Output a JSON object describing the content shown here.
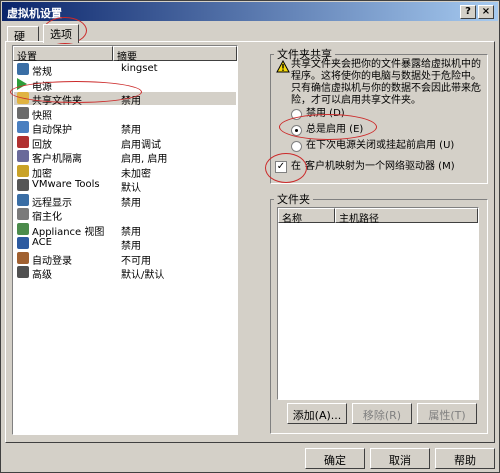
{
  "window": {
    "title": "虚拟机设置",
    "help_glyph": "?",
    "close_glyph": "×"
  },
  "tabs": [
    {
      "label": "硬件"
    },
    {
      "label": "选项"
    }
  ],
  "list": {
    "headers": {
      "setting": "设置",
      "summary": "摘要"
    },
    "items": [
      {
        "label": "常规",
        "summary": "kingset",
        "icon": "general-icon"
      },
      {
        "label": "电源",
        "summary": "",
        "icon": "power-icon"
      },
      {
        "label": "共享文件夹",
        "summary": "禁用",
        "icon": "folder-icon"
      },
      {
        "label": "快照",
        "summary": "",
        "icon": "snapshot-icon"
      },
      {
        "label": "自动保护",
        "summary": "禁用",
        "icon": "autoprotect-icon"
      },
      {
        "label": "回放",
        "summary": "启用调试",
        "icon": "replay-icon"
      },
      {
        "label": "客户机隔离",
        "summary": "启用, 启用",
        "icon": "isolation-icon"
      },
      {
        "label": "加密",
        "summary": "未加密",
        "icon": "lock-icon"
      },
      {
        "label": "VMware Tools",
        "summary": "默认",
        "icon": "vmware-tools-icon"
      },
      {
        "label": "远程显示",
        "summary": "禁用",
        "icon": "remote-display-icon"
      },
      {
        "label": "宿主化",
        "summary": "",
        "icon": "host-icon"
      },
      {
        "label": "Appliance 视图",
        "summary": "禁用",
        "icon": "appliance-icon"
      },
      {
        "label": "ACE",
        "summary": "禁用",
        "icon": "ace-icon"
      },
      {
        "label": "自动登录",
        "summary": "不可用",
        "icon": "autologin-icon"
      },
      {
        "label": "高级",
        "summary": "默认/默认",
        "icon": "advanced-icon"
      }
    ]
  },
  "sharing": {
    "group_label": "文件夹共享",
    "warning_lines": [
      "共享文件夹会把你的文件暴露给虚拟机中的",
      "程序。这将使你的电脑与数据处于危险中。",
      "只有确信虚拟机与你的数据不会因此带来危",
      "险，才可以启用共享文件夹。"
    ],
    "options": [
      {
        "label": "禁用 (D)",
        "selected": false
      },
      {
        "label": "总是启用 (E)",
        "selected": true
      },
      {
        "label": "在下次电源关闭或挂起前启用 (U)",
        "selected": false
      }
    ],
    "map_drive": {
      "checked": true,
      "label_prefix": "在",
      "label_rest": "客户机映射为一个网络驱动器 (M)"
    }
  },
  "folders": {
    "group_label": "文件夹",
    "columns": [
      "名称",
      "主机路径"
    ],
    "buttons": {
      "add": "添加(A)...",
      "remove": "移除(R)",
      "properties": "属性(T)"
    }
  },
  "footer": {
    "ok": "确定",
    "cancel": "取消",
    "help": "帮助"
  },
  "colors": {
    "annotation": "#cc2a2a",
    "titlebar_start": "#0a246a",
    "face": "#d4d0c8"
  }
}
